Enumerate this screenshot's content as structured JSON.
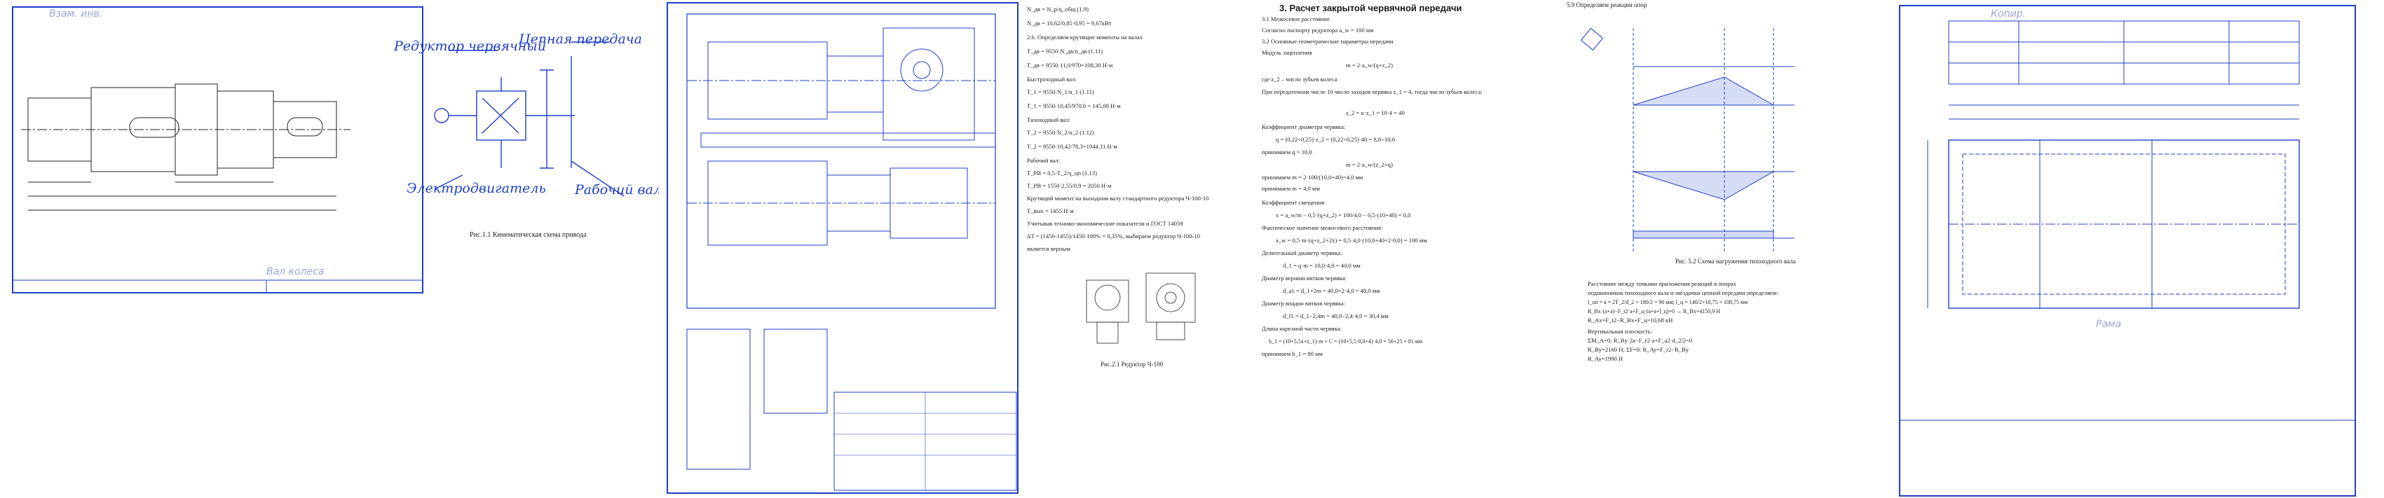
{
  "sheet1": {
    "stamp_top": "Взам. инв.",
    "stamp_bottom": "Вал колеса",
    "labels": {
      "reducer": "Редуктор червячный",
      "chain": "Цепная передача",
      "motor": "Электродвигатель",
      "shaft": "Рабочий вал"
    },
    "caption": "Рис.1.1 Кинематическая схема привода"
  },
  "sheet2": {
    "caption_small": "Рис.2.1 Редуктор Ч-100",
    "heading": "3. Расчет закрытой червячной передачи",
    "left_lines": [
      "N_дв = N_р/η_общ                                   (1.9)",
      "N_дв = 10,62/0,85·0,95 = 9,67кВт",
      "2.6. Определяем крутящие моменты на валах",
      "T_дв = 9550·N_дв/n_дв                              (1.11)",
      "T_дв = 9550·11,0/970=108,30 Н·м",
      "Быстроходный вал:",
      "T_1 = 9550·N_1/n_1                                 (1.11)",
      "T_1 = 9550·10,45/970,0 = 145,08 Н·м",
      "Тихоходный вал:",
      "T_2 = 9550·N_2/n_2                                 (1.12)",
      "T_2 = 9550·10,42/78,3=1944,11 Н·м",
      "Рабочий вал:",
      "T_РВ = 0,5·T_2/η_цп                                (1.13)",
      "T_РВ = 1550·2,55/0,9 = 2050 Н·м",
      "Крутящий момент на выходном валу стандартного редуктора Ч-100-10",
      "T_вых = 1455 Н·м",
      "Учитывая технико-экономические показатели и ГОСТ 14059",
      "ΔT = (1450-1455)/1450·100% = 0,35%, выбираем редуктор Ч-100-10",
      "является верным"
    ],
    "right_lines": [
      "3.1 Межосевое расстояние",
      "Согласно паспорту редуктора a_w = 100 мм",
      "3.2 Основные геометрические параметры передачи",
      "Модуль зацепления",
      "m = 2·a_w/(q+z_2)",
      "где z_2 – число зубьев колеса",
      "При передаточном числе 10 число заходов червяка z_1 = 4, тогда число зубьев колеса:",
      "z_2 = u·z_1 = 10·4 = 40",
      "Коэффициент диаметра червяка:",
      "q = (0,22÷0,25)·z_2 = (0,22÷0,25)·40 = 8,8÷10,0",
      "принимаем q = 10,0",
      "m = 2·a_w/(z_2+q)",
      "принимаем m = 2·100/(10,0+40)=4,0 мм",
      "принимаем m = 4,0 мм",
      "Коэффициент смещения",
      "x = a_w/m − 0,5·(q+z_2) = 100/4,0 − 0,5·(10+40) = 0,0",
      "Фактическое значение межосевого расстояния:",
      "a_w = 0,5·m·(q+z_2+2x) = 0,5·4,0·(10,0+40+2·0,0) = 100 мм",
      "Делительный диаметр червяка:",
      "d_1 = q·m = 10,0·4,0 = 40,0 мм",
      "Диаметр вершин витков червяка:",
      "d_a1 = d_1+2m = 40,0+2·4,0 = 48,0 мм",
      "Диаметр впадин витков червяка:",
      "d_f1 = d_1−2,4m = 40,0−2,4·4,0 = 30,4 мм",
      "Длина нарезной части червяка:",
      "b_1 = (10+5,5x+z_1)·m + C = (10+5,5·0,0+4)·4,0 = 56+25 = 81 мм",
      "принимаем b_1 = 80 мм"
    ]
  },
  "sheet3": {
    "heading": "5.9 Определяем реакции опор",
    "caption": "Рис. 5.2 Схема нагружения тихоходного вала",
    "bottom_lines": [
      "Расстояние между точками приложения реакций в опорах",
      "подшипников тихоходного вала и звёздочки цепной передачи определяем:",
      "l_оп = a = 2T_2/d_2 = 180/2 = 90 мм;  l_ц = 140/2+18,75 = 108,75 мм",
      "R_Bx·(a+a)−F_t2·a+F_ц·(a+a+l_ц)=0 → R_Bx=4150,9 Н",
      "R_Ax=F_t2−R_Bx+F_ц=10,68 кН",
      "Вертикальная плоскость:",
      "ΣM_A=0; R_By·2a−F_r2·a+F_a2·d_2/2=0",
      "R_By=2160 Н;  ΣF=0: R_Ay=F_r2−R_By",
      "R_Ay=1990 Н"
    ]
  },
  "sheet4": {
    "stamp_top": "Копир.",
    "stamp_bottom": "Рама"
  }
}
